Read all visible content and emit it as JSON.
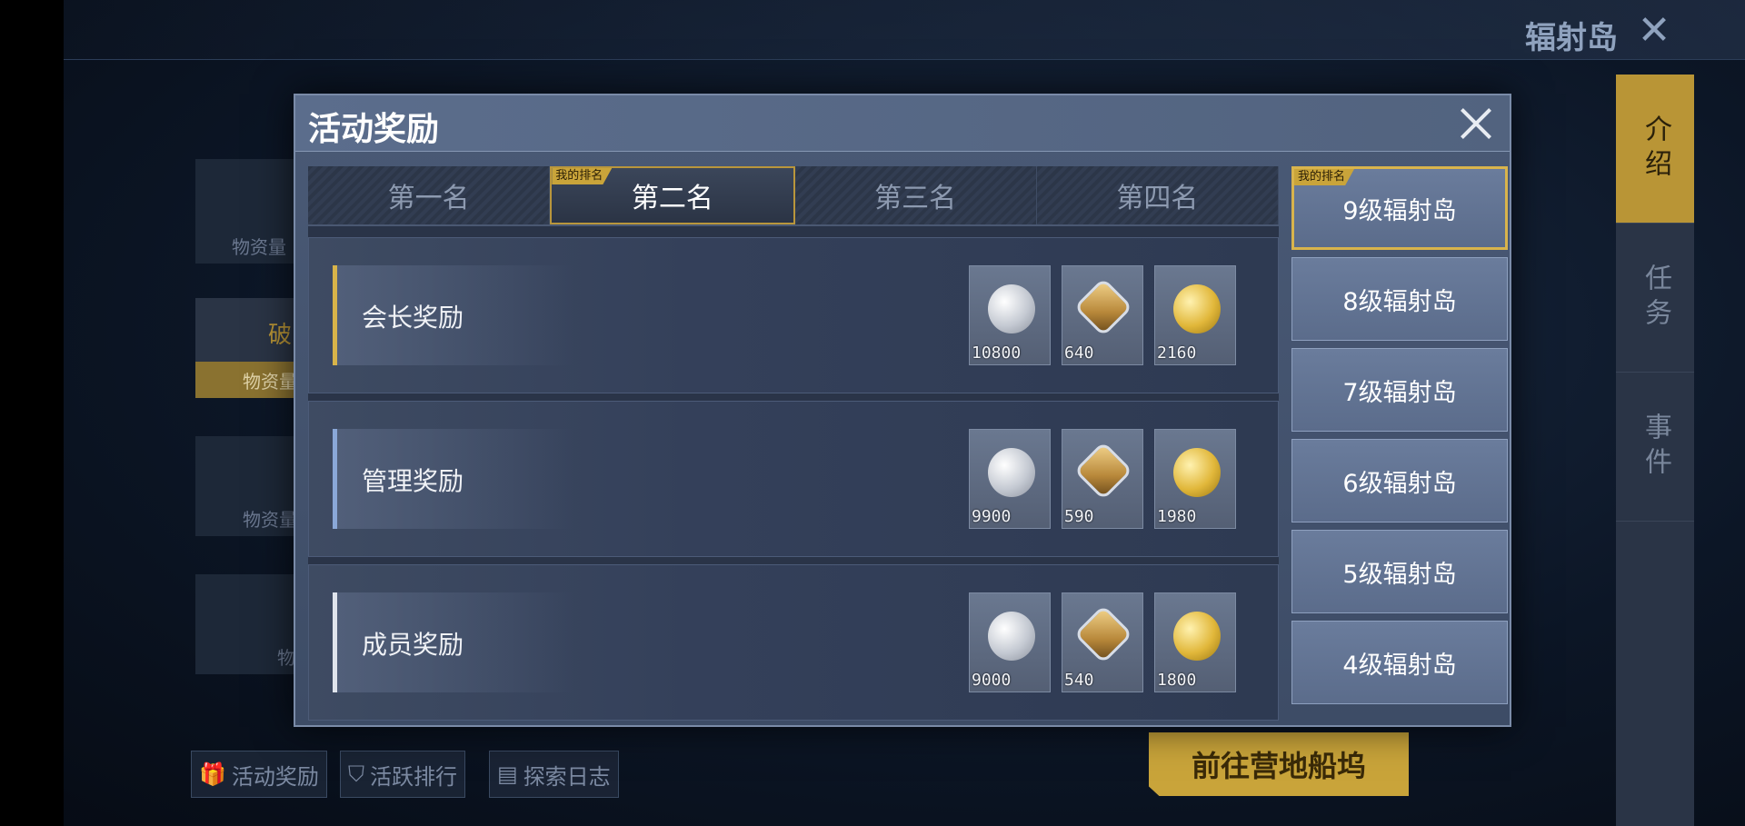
{
  "background": {
    "top_title": "辐射岛",
    "left_panel": {
      "labels": [
        "物资量",
        "破",
        "物资量",
        "物资量",
        "物"
      ]
    },
    "bottom_buttons": [
      "活动奖励",
      "活跃排行",
      "探索日志"
    ],
    "go_dock_label": "前往营地船坞",
    "side_tabs": [
      "介绍",
      "任务",
      "事件"
    ]
  },
  "modal": {
    "title": "活动奖励",
    "my_rank_badge": "我的排名",
    "rank_tabs": [
      {
        "label": "第一名",
        "active": false
      },
      {
        "label": "第二名",
        "active": true
      },
      {
        "label": "第三名",
        "active": false
      },
      {
        "label": "第四名",
        "active": false
      }
    ],
    "rewards": [
      {
        "label": "会长奖励",
        "items": [
          {
            "icon": "silver-coin-icon",
            "qty": "10800"
          },
          {
            "icon": "badge-icon",
            "qty": "640"
          },
          {
            "icon": "gold-coin-icon",
            "qty": "2160"
          }
        ]
      },
      {
        "label": "管理奖励",
        "items": [
          {
            "icon": "silver-coin-icon",
            "qty": "9900"
          },
          {
            "icon": "badge-icon",
            "qty": "590"
          },
          {
            "icon": "gold-coin-icon",
            "qty": "1980"
          }
        ]
      },
      {
        "label": "成员奖励",
        "items": [
          {
            "icon": "silver-coin-icon",
            "qty": "9000"
          },
          {
            "icon": "badge-icon",
            "qty": "540"
          },
          {
            "icon": "gold-coin-icon",
            "qty": "1800"
          }
        ]
      }
    ],
    "islands": [
      {
        "label": "9级辐射岛",
        "active": true
      },
      {
        "label": "8级辐射岛",
        "active": false
      },
      {
        "label": "7级辐射岛",
        "active": false
      },
      {
        "label": "6级辐射岛",
        "active": false
      },
      {
        "label": "5级辐射岛",
        "active": false
      },
      {
        "label": "4级辐射岛",
        "active": false
      }
    ]
  },
  "colors": {
    "accent_gold": "#c9a43a",
    "panel_blue": "#4a5a76"
  }
}
